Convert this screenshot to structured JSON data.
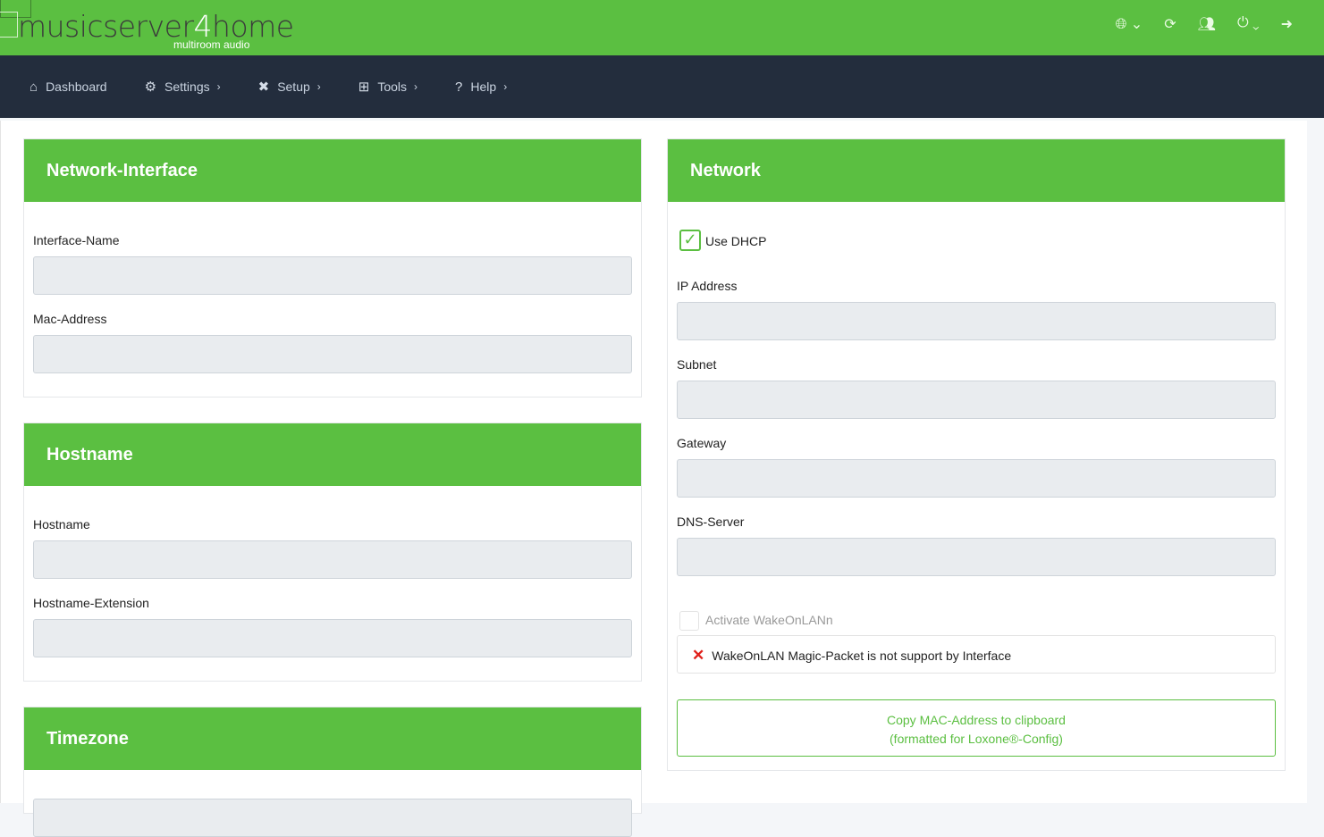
{
  "brand": {
    "name_a": "musicserver",
    "name_b": "4",
    "name_c": "home",
    "tagline": "multiroom audio"
  },
  "top_icons": [
    "globe-icon",
    "refresh-icon",
    "users-cog-icon",
    "power-icon",
    "sign-out-icon"
  ],
  "nav": [
    {
      "label": "Dashboard",
      "icon": "home-icon"
    },
    {
      "label": "Settings",
      "icon": "gear-icon"
    },
    {
      "label": "Setup",
      "icon": "tools-icon"
    },
    {
      "label": "Tools",
      "icon": "plus-square-icon"
    },
    {
      "label": "Help",
      "icon": "question-icon"
    }
  ],
  "panels": {
    "network_interface": {
      "title": "Network-Interface",
      "fields": [
        {
          "label": "Interface-Name",
          "value": ""
        },
        {
          "label": "Mac-Address",
          "value": ""
        }
      ]
    },
    "hostname": {
      "title": "Hostname",
      "fields": [
        {
          "label": "Hostname",
          "value": ""
        },
        {
          "label": "Hostname-Extension",
          "value": ""
        }
      ]
    },
    "timezone": {
      "title": "Timezone"
    },
    "network": {
      "title": "Network",
      "dhcp_label": "Use DHCP",
      "dhcp_checked": true,
      "fields": [
        {
          "label": "IP Address",
          "value": ""
        },
        {
          "label": "Subnet",
          "value": ""
        },
        {
          "label": "Gateway",
          "value": ""
        },
        {
          "label": "DNS-Server",
          "value": ""
        }
      ],
      "wol_label": "Activate WakeOnLANn",
      "wol_checked": false,
      "wol_alert": "WakeOnLAN Magic-Packet is not support by Interface",
      "copy_line1": "Copy MAC-Address to clipboard",
      "copy_line2": "(formatted for Loxone®-Config)"
    }
  },
  "colors": {
    "brand_green": "#5bbf41",
    "nav_bg": "#232d3d",
    "error": "#e0201b"
  }
}
